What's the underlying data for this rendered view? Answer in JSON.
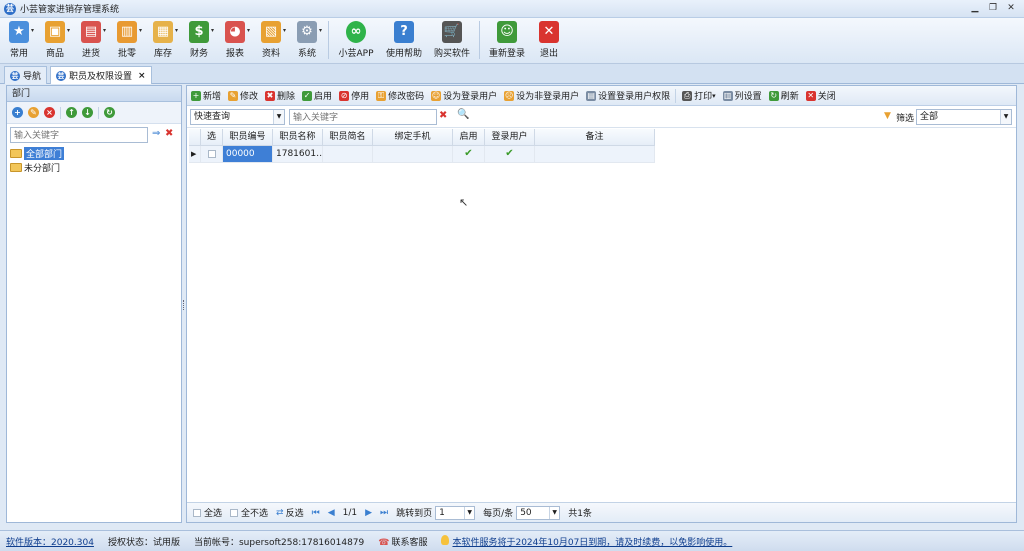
{
  "window": {
    "title": "小芸管家进销存管理系统",
    "icon_text": "芸"
  },
  "ribbon": {
    "items": [
      {
        "label": "常用",
        "icon": "star-icon",
        "color": "#4a8fdc"
      },
      {
        "label": "商品",
        "icon": "box-icon",
        "color": "#e8a132"
      },
      {
        "label": "进货",
        "icon": "purchase-icon",
        "color": "#d9534f"
      },
      {
        "label": "批零",
        "icon": "wholesale-icon",
        "color": "#e89a32"
      },
      {
        "label": "库存",
        "icon": "stock-icon",
        "color": "#e6b24a"
      },
      {
        "label": "财务",
        "icon": "finance-icon",
        "color": "#3f9a3a"
      },
      {
        "label": "报表",
        "icon": "pie-chart-icon",
        "color": "#d9534f"
      },
      {
        "label": "资料",
        "icon": "document-icon",
        "color": "#e8a132"
      },
      {
        "label": "系统",
        "icon": "gears-icon",
        "color": "#8a9db3"
      },
      {
        "label": "小芸APP",
        "icon": "app-icon",
        "color": "#2fb34a"
      },
      {
        "label": "使用帮助",
        "icon": "help-icon",
        "color": "#3a7fd0"
      },
      {
        "label": "购买软件",
        "icon": "cart-icon",
        "color": "#555555"
      },
      {
        "label": "重新登录",
        "icon": "relogin-icon",
        "color": "#3f9a3a"
      },
      {
        "label": "退出",
        "icon": "exit-icon",
        "color": "#d9342f"
      }
    ]
  },
  "tabs": [
    {
      "label": "导航"
    },
    {
      "label": "职员及权限设置",
      "close": "×"
    }
  ],
  "left": {
    "title": "部门",
    "search_placeholder": "输入关键字",
    "tree": [
      {
        "label": "全部部门",
        "selected": true
      },
      {
        "label": "未分部门",
        "selected": false
      }
    ]
  },
  "toolbar": {
    "items": [
      {
        "label": "新增",
        "icon": "add-icon",
        "color": "#3f9a3a"
      },
      {
        "label": "修改",
        "icon": "edit-icon",
        "color": "#e8a132"
      },
      {
        "label": "删除",
        "icon": "delete-icon",
        "color": "#d9342f"
      },
      {
        "label": "启用",
        "icon": "enable-icon",
        "color": "#3f9a3a"
      },
      {
        "label": "停用",
        "icon": "disable-icon",
        "color": "#d9342f"
      },
      {
        "label": "修改密码",
        "icon": "key-icon",
        "color": "#e8a132"
      },
      {
        "label": "设为登录用户",
        "icon": "user-icon",
        "color": "#e8a132"
      },
      {
        "label": "设为非登录用户",
        "icon": "user-off-icon",
        "color": "#e8a132"
      },
      {
        "label": "设置登录用户权限",
        "icon": "permission-icon",
        "color": "#7a8ca3"
      },
      {
        "label": "打印",
        "icon": "print-icon",
        "color": "#555555"
      },
      {
        "label": "列设置",
        "icon": "columns-icon",
        "color": "#7a8ca3"
      },
      {
        "label": "刷新",
        "icon": "refresh-icon",
        "color": "#3f9a3a"
      },
      {
        "label": "关闭",
        "icon": "close-icon",
        "color": "#d9342f"
      }
    ]
  },
  "filter": {
    "mode": "快速查询",
    "keyword_placeholder": "输入关键字",
    "filter_label": "筛选",
    "filter_value": "全部"
  },
  "grid": {
    "columns": [
      "选",
      "职员编号",
      "职员名称",
      "职员简名",
      "绑定手机",
      "启用",
      "登录用户",
      "备注"
    ],
    "rows": [
      {
        "code": "00000",
        "name": "1781601…",
        "short": "",
        "phone": "",
        "enabled": "✔",
        "login": "✔",
        "note": ""
      }
    ]
  },
  "pager": {
    "select_all": "全选",
    "select_none": "全不选",
    "invert": "反选",
    "page": "1/1",
    "jump_label": "跳转到页",
    "jump_value": "1",
    "per_page_label": "每页/条",
    "per_page_value": "50",
    "total": "共1条"
  },
  "status": {
    "version": "软件版本：2020.304",
    "license": "授权状态：试用版",
    "account": "当前帐号：supersoft258:17816014879",
    "support": "联系客服",
    "notice": "本软件服务将于2024年10月07日到期，请及时续费，以免影响使用。"
  }
}
